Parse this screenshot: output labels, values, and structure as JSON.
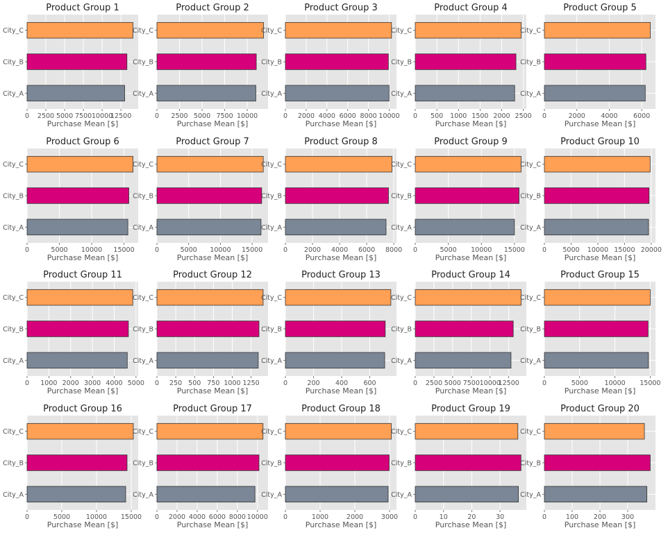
{
  "figure": {
    "colors": {
      "background": "#e5e5e5",
      "grid": "#ffffff",
      "text": "#555555",
      "title": "#222222",
      "bar_edge": "#333333",
      "series": [
        "#7b8796",
        "#d6007a",
        "#ffa055"
      ]
    }
  },
  "chart_data": [
    {
      "type": "bar",
      "orientation": "horizontal",
      "title": "Product Group 1",
      "xlabel": "Purchase Mean [$]",
      "categories": [
        "City_A",
        "City_B",
        "City_C"
      ],
      "values": [
        13000,
        13300,
        14100
      ],
      "xlim": [
        0,
        14800
      ],
      "xticks": [
        0,
        2500,
        5000,
        7500,
        10000,
        12500
      ],
      "xtick_labels": [
        "0",
        "2500",
        "5000",
        "7500",
        "10000",
        "12500"
      ],
      "grid": true
    },
    {
      "type": "bar",
      "orientation": "horizontal",
      "title": "Product Group 2",
      "xlabel": "Purchase Mean [$]",
      "categories": [
        "City_A",
        "City_B",
        "City_C"
      ],
      "values": [
        10950,
        11000,
        11800
      ],
      "xlim": [
        0,
        12300
      ],
      "xticks": [
        0,
        2500,
        5000,
        7500,
        10000
      ],
      "xtick_labels": [
        "0",
        "2500",
        "5000",
        "7500",
        "10000"
      ],
      "grid": true
    },
    {
      "type": "bar",
      "orientation": "horizontal",
      "title": "Product Group 3",
      "xlabel": "Purchase Mean [$]",
      "categories": [
        "City_A",
        "City_B",
        "City_C"
      ],
      "values": [
        9980,
        9920,
        10220
      ],
      "xlim": [
        0,
        10700
      ],
      "xticks": [
        0,
        2000,
        4000,
        6000,
        8000,
        10000
      ],
      "xtick_labels": [
        "0",
        "2000",
        "4000",
        "6000",
        "8000",
        "10000"
      ],
      "grid": true
    },
    {
      "type": "bar",
      "orientation": "horizontal",
      "title": "Product Group 4",
      "xlabel": "Purchase Mean [$]",
      "categories": [
        "City_A",
        "City_B",
        "City_C"
      ],
      "values": [
        2300,
        2330,
        2450
      ],
      "xlim": [
        0,
        2570
      ],
      "xticks": [
        0,
        500,
        1000,
        1500,
        2000,
        2500
      ],
      "xtick_labels": [
        "0",
        "500",
        "1000",
        "1500",
        "2000",
        "2500"
      ],
      "grid": true
    },
    {
      "type": "bar",
      "orientation": "horizontal",
      "title": "Product Group 5",
      "xlabel": "Purchase Mean [$]",
      "categories": [
        "City_A",
        "City_B",
        "City_C"
      ],
      "values": [
        6220,
        6260,
        6530
      ],
      "xlim": [
        0,
        6850
      ],
      "xticks": [
        0,
        2000,
        4000,
        6000
      ],
      "xtick_labels": [
        "0",
        "2000",
        "4000",
        "6000"
      ],
      "grid": true
    },
    {
      "type": "bar",
      "orientation": "horizontal",
      "title": "Product Group 6",
      "xlabel": "Purchase Mean [$]",
      "categories": [
        "City_A",
        "City_B",
        "City_C"
      ],
      "values": [
        15600,
        15750,
        16400
      ],
      "xlim": [
        0,
        17200
      ],
      "xticks": [
        0,
        5000,
        10000,
        15000
      ],
      "xtick_labels": [
        "0",
        "5000",
        "10000",
        "15000"
      ],
      "grid": true
    },
    {
      "type": "bar",
      "orientation": "horizontal",
      "title": "Product Group 7",
      "xlabel": "Purchase Mean [$]",
      "categories": [
        "City_A",
        "City_B",
        "City_C"
      ],
      "values": [
        16400,
        16500,
        16750
      ],
      "xlim": [
        0,
        17500
      ],
      "xticks": [
        0,
        5000,
        10000,
        15000
      ],
      "xtick_labels": [
        "0",
        "5000",
        "10000",
        "15000"
      ],
      "grid": true
    },
    {
      "type": "bar",
      "orientation": "horizontal",
      "title": "Product Group 8",
      "xlabel": "Purchase Mean [$]",
      "categories": [
        "City_A",
        "City_B",
        "City_C"
      ],
      "values": [
        7430,
        7610,
        7860
      ],
      "xlim": [
        0,
        8200
      ],
      "xticks": [
        0,
        2000,
        4000,
        6000,
        8000
      ],
      "xtick_labels": [
        "0",
        "2000",
        "4000",
        "6000",
        "8000"
      ],
      "grid": true
    },
    {
      "type": "bar",
      "orientation": "horizontal",
      "title": "Product Group 9",
      "xlabel": "Purchase Mean [$]",
      "categories": [
        "City_A",
        "City_B",
        "City_C"
      ],
      "values": [
        15000,
        15700,
        16000
      ],
      "xlim": [
        0,
        16800
      ],
      "xticks": [
        0,
        5000,
        10000,
        15000
      ],
      "xtick_labels": [
        "0",
        "5000",
        "10000",
        "15000"
      ],
      "grid": true
    },
    {
      "type": "bar",
      "orientation": "horizontal",
      "title": "Product Group 10",
      "xlabel": "Purchase Mean [$]",
      "categories": [
        "City_A",
        "City_B",
        "City_C"
      ],
      "values": [
        19500,
        19600,
        19800
      ],
      "xlim": [
        0,
        20800
      ],
      "xticks": [
        0,
        5000,
        10000,
        15000,
        20000
      ],
      "xtick_labels": [
        "0",
        "5000",
        "10000",
        "15000",
        "20000"
      ],
      "grid": true
    },
    {
      "type": "bar",
      "orientation": "horizontal",
      "title": "Product Group 11",
      "xlabel": "Purchase Mean [$]",
      "categories": [
        "City_A",
        "City_B",
        "City_C"
      ],
      "values": [
        4600,
        4650,
        4850
      ],
      "xlim": [
        0,
        5100
      ],
      "xticks": [
        0,
        1000,
        2000,
        3000,
        4000,
        5000
      ],
      "xtick_labels": [
        "0",
        "1000",
        "2000",
        "3000",
        "4000",
        "5000"
      ],
      "grid": true
    },
    {
      "type": "bar",
      "orientation": "horizontal",
      "title": "Product Group 12",
      "xlabel": "Purchase Mean [$]",
      "categories": [
        "City_A",
        "City_B",
        "City_C"
      ],
      "values": [
        1345,
        1355,
        1410
      ],
      "xlim": [
        0,
        1475
      ],
      "xticks": [
        0,
        250,
        500,
        750,
        1000,
        1250
      ],
      "xtick_labels": [
        "0",
        "250",
        "500",
        "750",
        "1000",
        "1250"
      ],
      "grid": true
    },
    {
      "type": "bar",
      "orientation": "horizontal",
      "title": "Product Group 13",
      "xlabel": "Purchase Mean [$]",
      "categories": [
        "City_A",
        "City_B",
        "City_C"
      ],
      "values": [
        706,
        710,
        750
      ],
      "xlim": [
        0,
        790
      ],
      "xticks": [
        0,
        200,
        400,
        600
      ],
      "xtick_labels": [
        "0",
        "200",
        "400",
        "600"
      ],
      "grid": true
    },
    {
      "type": "bar",
      "orientation": "horizontal",
      "title": "Product Group 14",
      "xlabel": "Purchase Mean [$]",
      "categories": [
        "City_A",
        "City_B",
        "City_C"
      ],
      "values": [
        12800,
        13100,
        14150
      ],
      "xlim": [
        0,
        14850
      ],
      "xticks": [
        0,
        2500,
        5000,
        7500,
        10000,
        12500
      ],
      "xtick_labels": [
        "0",
        "2500",
        "5000",
        "7500",
        "10000",
        "12500"
      ],
      "grid": true
    },
    {
      "type": "bar",
      "orientation": "horizontal",
      "title": "Product Group 15",
      "xlabel": "Purchase Mean [$]",
      "categories": [
        "City_A",
        "City_B",
        "City_C"
      ],
      "values": [
        14750,
        14700,
        15000
      ],
      "xlim": [
        0,
        15750
      ],
      "xticks": [
        0,
        5000,
        10000,
        15000
      ],
      "xtick_labels": [
        "0",
        "5000",
        "10000",
        "15000"
      ],
      "grid": true
    },
    {
      "type": "bar",
      "orientation": "horizontal",
      "title": "Product Group 16",
      "xlabel": "Purchase Mean [$]",
      "categories": [
        "City_A",
        "City_B",
        "City_C"
      ],
      "values": [
        14200,
        14400,
        15300
      ],
      "xlim": [
        0,
        16000
      ],
      "xticks": [
        0,
        5000,
        10000,
        15000
      ],
      "xtick_labels": [
        "0",
        "5000",
        "10000",
        "15000"
      ],
      "grid": true
    },
    {
      "type": "bar",
      "orientation": "horizontal",
      "title": "Product Group 17",
      "xlabel": "Purchase Mean [$]",
      "categories": [
        "City_A",
        "City_B",
        "City_C"
      ],
      "values": [
        9750,
        10150,
        10550
      ],
      "xlim": [
        0,
        11050
      ],
      "xticks": [
        0,
        2000,
        4000,
        6000,
        8000,
        10000
      ],
      "xtick_labels": [
        "0",
        "2000",
        "4000",
        "6000",
        "8000",
        "10000"
      ],
      "grid": true
    },
    {
      "type": "bar",
      "orientation": "horizontal",
      "title": "Product Group 18",
      "xlabel": "Purchase Mean [$]",
      "categories": [
        "City_A",
        "City_B",
        "City_C"
      ],
      "values": [
        2960,
        2990,
        3050
      ],
      "xlim": [
        0,
        3200
      ],
      "xticks": [
        0,
        1000,
        2000,
        3000
      ],
      "xtick_labels": [
        "0",
        "1000",
        "2000",
        "3000"
      ],
      "grid": true
    },
    {
      "type": "bar",
      "orientation": "horizontal",
      "title": "Product Group 19",
      "xlabel": "Purchase Mean [$]",
      "categories": [
        "City_A",
        "City_B",
        "City_C"
      ],
      "values": [
        36.5,
        37.4,
        36.3
      ],
      "xlim": [
        0,
        39.3
      ],
      "xticks": [
        0,
        10,
        20,
        30
      ],
      "xtick_labels": [
        "0",
        "10",
        "20",
        "30"
      ],
      "grid": true
    },
    {
      "type": "bar",
      "orientation": "horizontal",
      "title": "Product Group 20",
      "xlabel": "Purchase Mean [$]",
      "categories": [
        "City_A",
        "City_B",
        "City_C"
      ],
      "values": [
        369,
        381,
        360
      ],
      "xlim": [
        0,
        400
      ],
      "xticks": [
        0,
        100,
        200,
        300
      ],
      "xtick_labels": [
        "0",
        "100",
        "200",
        "300"
      ],
      "grid": true
    }
  ]
}
